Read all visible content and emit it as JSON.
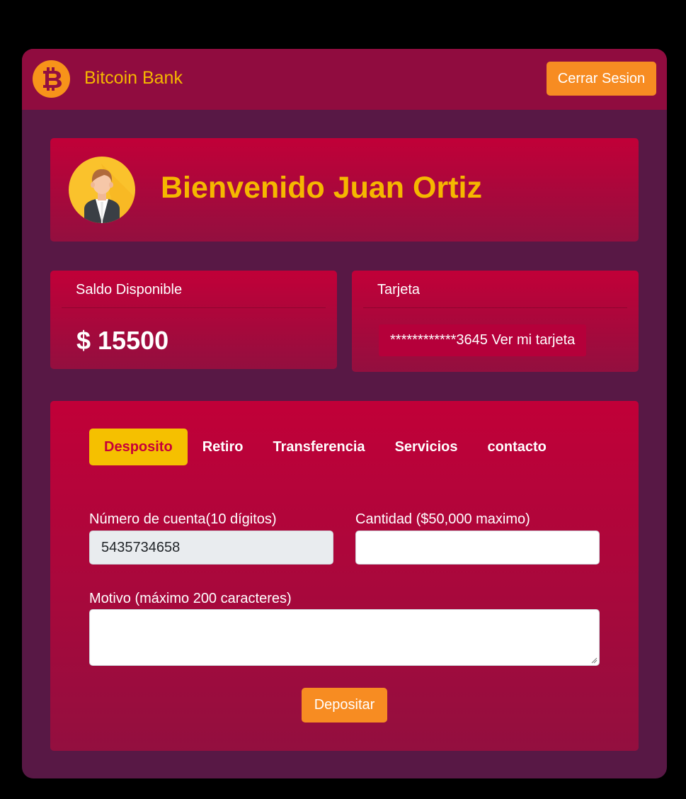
{
  "navbar": {
    "logo_icon": "bitcoin-icon",
    "brand": "Bitcoin Bank",
    "logout_label": "Cerrar Sesion"
  },
  "welcome": {
    "avatar_icon": "user-avatar-icon",
    "text": "Bienvenido Juan Ortiz"
  },
  "balance": {
    "title": "Saldo Disponible",
    "value": "$ 15500"
  },
  "card": {
    "title": "Tarjeta",
    "link_text": "************3645 Ver mi tarjeta"
  },
  "operations": {
    "tabs": [
      {
        "label": "Desposito",
        "active": true
      },
      {
        "label": "Retiro",
        "active": false
      },
      {
        "label": "Transferencia",
        "active": false
      },
      {
        "label": "Servicios",
        "active": false
      },
      {
        "label": "contacto",
        "active": false
      }
    ],
    "account_label": "Número de cuenta(10 dígitos)",
    "account_value": "5435734658",
    "amount_label": "Cantidad ($50,000 maximo)",
    "amount_value": "",
    "reason_label": "Motivo (máximo 200 caracteres)",
    "reason_value": "",
    "submit_label": "Depositar"
  },
  "colors": {
    "page_bg": "#000000",
    "app_bg": "#581845",
    "navbar_bg": "#900c3f",
    "card_gradient_top": "#c10038",
    "card_gradient_bottom": "#930f3f",
    "accent_yellow": "#f5b700",
    "button_orange": "#f78c22",
    "active_tab_bg": "#f5c000",
    "active_tab_text": "#c70039"
  }
}
